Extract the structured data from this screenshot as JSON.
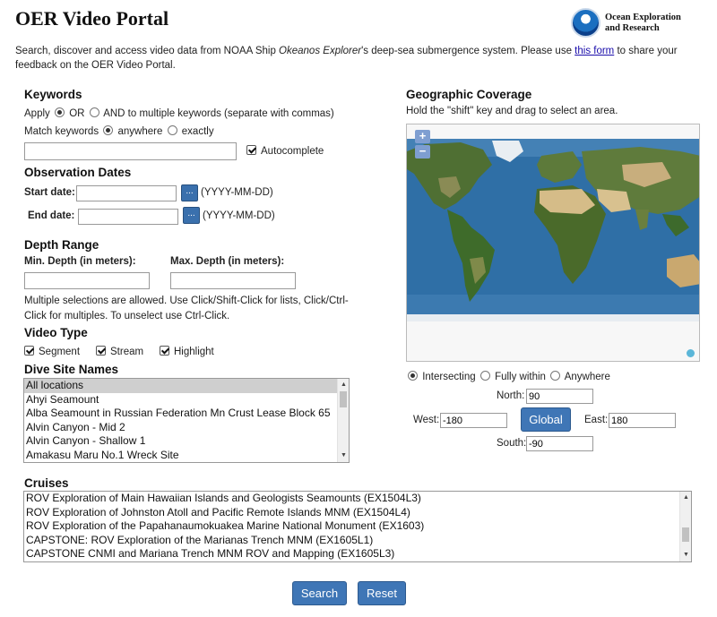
{
  "header": {
    "title": "OER Video Portal",
    "logo_text_line1": "Ocean Exploration",
    "logo_text_line2": "and Research"
  },
  "intro": {
    "text_before_ship": "Search, discover and access video data from NOAA Ship ",
    "ship_name": "Okeanos Explorer",
    "text_after_ship": "'s deep-sea submergence system. Please use ",
    "link_text": "this form",
    "text_after_link": " to share your feedback on the OER Video Portal."
  },
  "keywords": {
    "heading": "Keywords",
    "apply_label": "Apply",
    "or_label": "OR",
    "and_label": "AND to multiple keywords (separate with commas)",
    "match_label": "Match keywords",
    "anywhere_label": "anywhere",
    "exactly_label": "exactly",
    "input_value": "",
    "autocomplete_label": "Autocomplete"
  },
  "dates": {
    "heading": "Observation Dates",
    "start_label": "Start date:",
    "end_label": "End date:",
    "start_value": "",
    "end_value": "",
    "format_hint": "(YYYY-MM-DD)",
    "cal_button": "..."
  },
  "depth": {
    "heading": "Depth Range",
    "min_label": "Min. Depth (in meters):",
    "max_label": "Max. Depth (in meters):",
    "min_value": "",
    "max_value": "",
    "help_line1": "Multiple selections are allowed. Use Click/Shift-Click for lists, Click/Ctrl-",
    "help_line2": "Click for multiples. To unselect use Ctrl-Click."
  },
  "video_type": {
    "heading": "Video Type",
    "options": [
      {
        "label": "Segment",
        "checked": true
      },
      {
        "label": "Stream",
        "checked": true
      },
      {
        "label": "Highlight",
        "checked": true
      }
    ]
  },
  "dive_sites": {
    "heading": "Dive Site Names",
    "items": [
      "All locations",
      "Ahyi Seamount",
      "Alba Seamount in Russian Federation Mn Crust Lease Block 65",
      "Alvin Canyon - Mid 2",
      "Alvin Canyon - Shallow 1",
      "Amakasu Maru No.1 Wreck Site"
    ],
    "selected_index": 0
  },
  "geo": {
    "heading": "Geographic Coverage",
    "hint": "Hold the \"shift\" key and drag to select an area.",
    "zoom_in": "+",
    "zoom_out": "−",
    "intersecting_label": "Intersecting",
    "fully_within_label": "Fully within",
    "anywhere_label": "Anywhere",
    "mode": "Intersecting",
    "north_label": "North:",
    "south_label": "South:",
    "west_label": "West:",
    "east_label": "East:",
    "north_value": "90",
    "south_value": "-90",
    "west_value": "-180",
    "east_value": "180",
    "global_button": "Global"
  },
  "cruises": {
    "heading": "Cruises",
    "items": [
      "ROV Exploration of Main Hawaiian Islands and Geologists Seamounts (EX1504L3)",
      "ROV Exploration of Johnston Atoll and Pacific Remote Islands MNM (EX1504L4)",
      "ROV Exploration of the Papahanaumokuakea Marine National Monument (EX1603)",
      "CAPSTONE: ROV Exploration of the Marianas Trench MNM (EX1605L1)",
      "CAPSTONE CNMI and Mariana Trench MNM ROV and Mapping (EX1605L3)"
    ]
  },
  "actions": {
    "search_label": "Search",
    "reset_label": "Reset"
  },
  "colors": {
    "button_blue": "#3f76b6",
    "ocean": "#2d6fa8",
    "land_green": "#4d6e2e",
    "desert": "#d2b986"
  }
}
